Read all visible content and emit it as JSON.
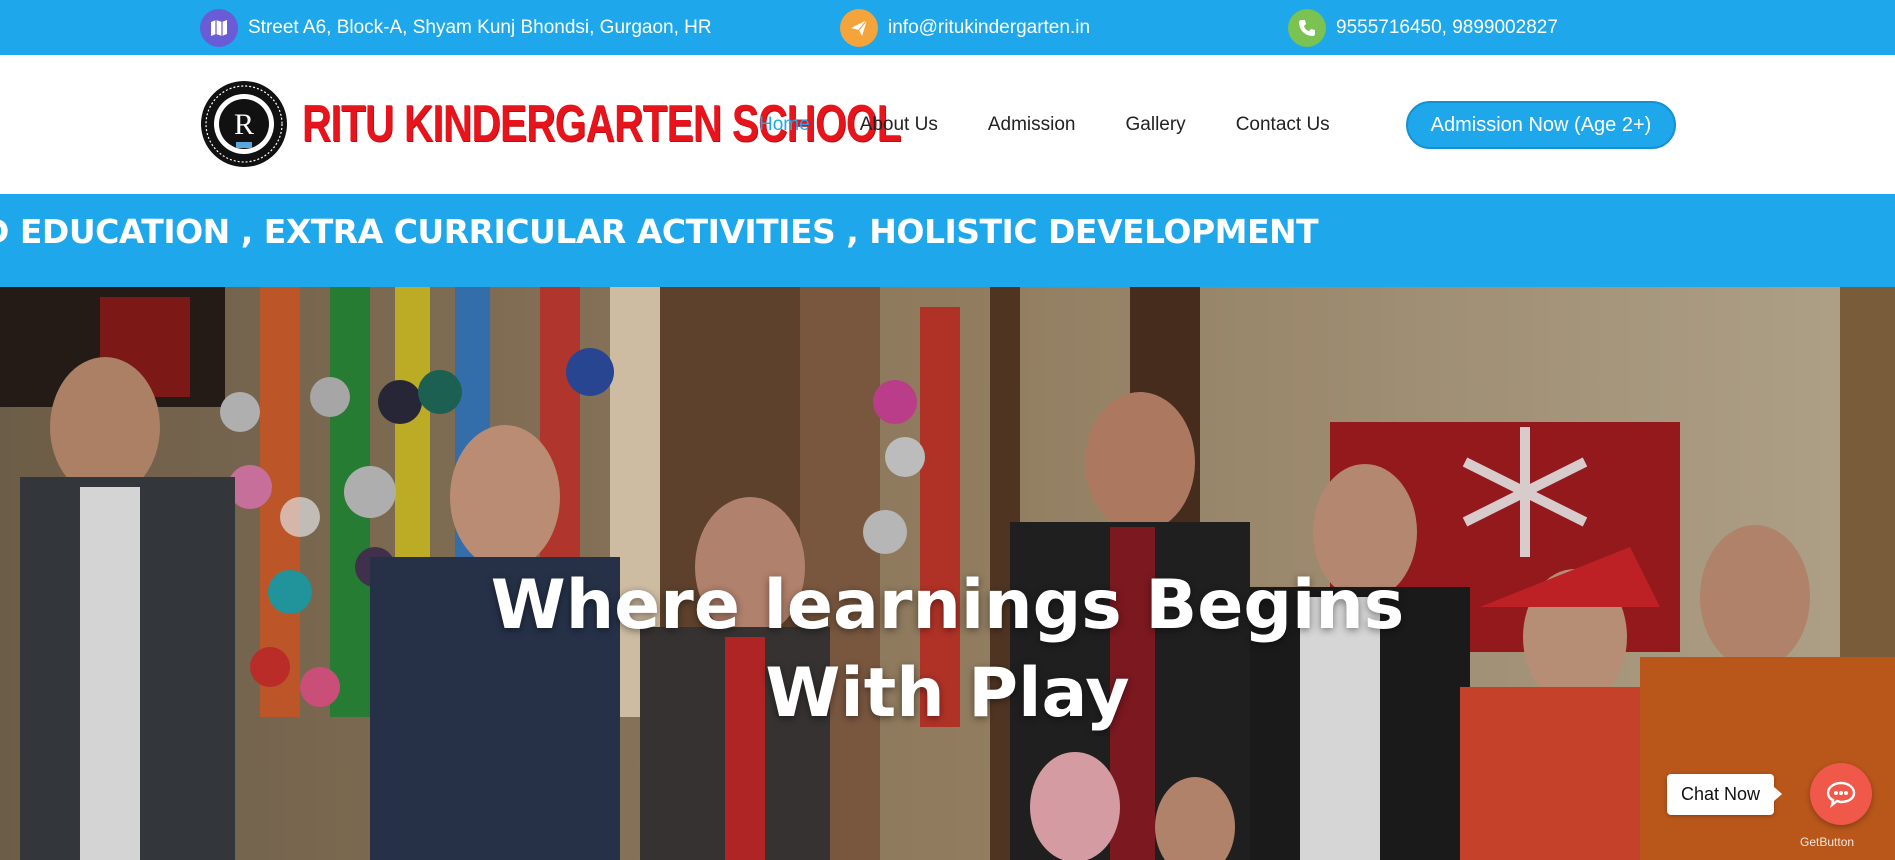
{
  "topbar": {
    "address": "Street A6, Block-A, Shyam Kunj Bhondsi, Gurgaon, HR",
    "email": "info@ritukindergarten.in",
    "phone": "9555716450, 9899002827",
    "icons": [
      "map-icon",
      "paper-plane-icon",
      "phone-icon"
    ],
    "icon_colors": [
      "#6a5bd6",
      "#f5a33b",
      "#7ac251"
    ]
  },
  "header": {
    "logo_text": "RITU KINDERGARTEN SCHOOL",
    "nav": [
      "Home",
      "About Us",
      "Admission",
      "Gallery",
      "Contact Us"
    ],
    "active_nav": "Home",
    "cta_label": "Admission Now (Age 2+)"
  },
  "marquee": {
    "text": "D EDUCATION , EXTRA CURRICULAR ACTIVITIES , HOLISTIC DEVELOPMENT"
  },
  "hero": {
    "title_line1": "Where learnings Begins",
    "title_line2": "With Play"
  },
  "chat": {
    "label": "Chat Now",
    "provider": "GetButton"
  },
  "colors": {
    "primary": "#1ea7ea",
    "logo_red": "#e8141b",
    "chat_red": "#f0584a"
  }
}
